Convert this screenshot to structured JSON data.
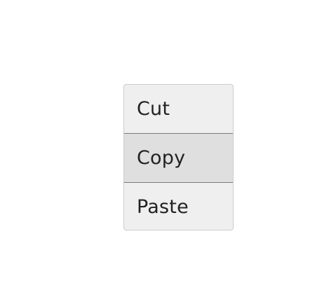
{
  "context_menu": {
    "items": [
      {
        "label": "Cut",
        "highlighted": false
      },
      {
        "label": "Copy",
        "highlighted": true
      },
      {
        "label": "Paste",
        "highlighted": false
      }
    ]
  }
}
